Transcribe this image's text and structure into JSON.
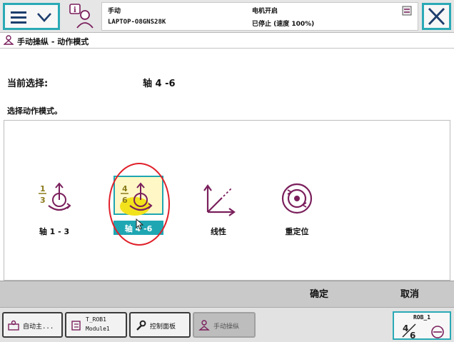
{
  "header": {
    "mode": "手动",
    "system_name": "LAPTOP-O8GNS28K",
    "motor_state": "电机开启",
    "run_state": "已停止 (速度 100%)"
  },
  "title": {
    "text": "手动操纵 - 动作模式"
  },
  "selection": {
    "label": "当前选择:",
    "value": "轴 4 -6",
    "instruction": "选择动作模式。"
  },
  "modes": [
    {
      "label": "轴 1 - 3",
      "icon": "axis-1-3-icon",
      "selected": false
    },
    {
      "label": "轴 4 -6",
      "icon": "axis-4-6-icon",
      "selected": true
    },
    {
      "label": "线性",
      "icon": "linear-icon",
      "selected": false
    },
    {
      "label": "重定位",
      "icon": "reorient-icon",
      "selected": false
    }
  ],
  "commands": {
    "ok": "确定",
    "cancel": "取消"
  },
  "taskbar": {
    "items": [
      {
        "label": "自动主...",
        "icon": "auto-production-icon"
      },
      {
        "label": "T_ROB1",
        "sublabel": "Module1",
        "icon": "program-editor-icon"
      },
      {
        "label": "控制面板",
        "icon": "wrench-icon"
      },
      {
        "label": "手动操纵",
        "icon": "jogging-icon",
        "active": true
      }
    ],
    "quickset": {
      "robot": "ROB_1"
    }
  },
  "colors": {
    "accent": "#2aa9b5",
    "icon_purple": "#7a1f5c",
    "highlight_yellow": "#f2e21c",
    "annotation_red": "#e0202a"
  }
}
